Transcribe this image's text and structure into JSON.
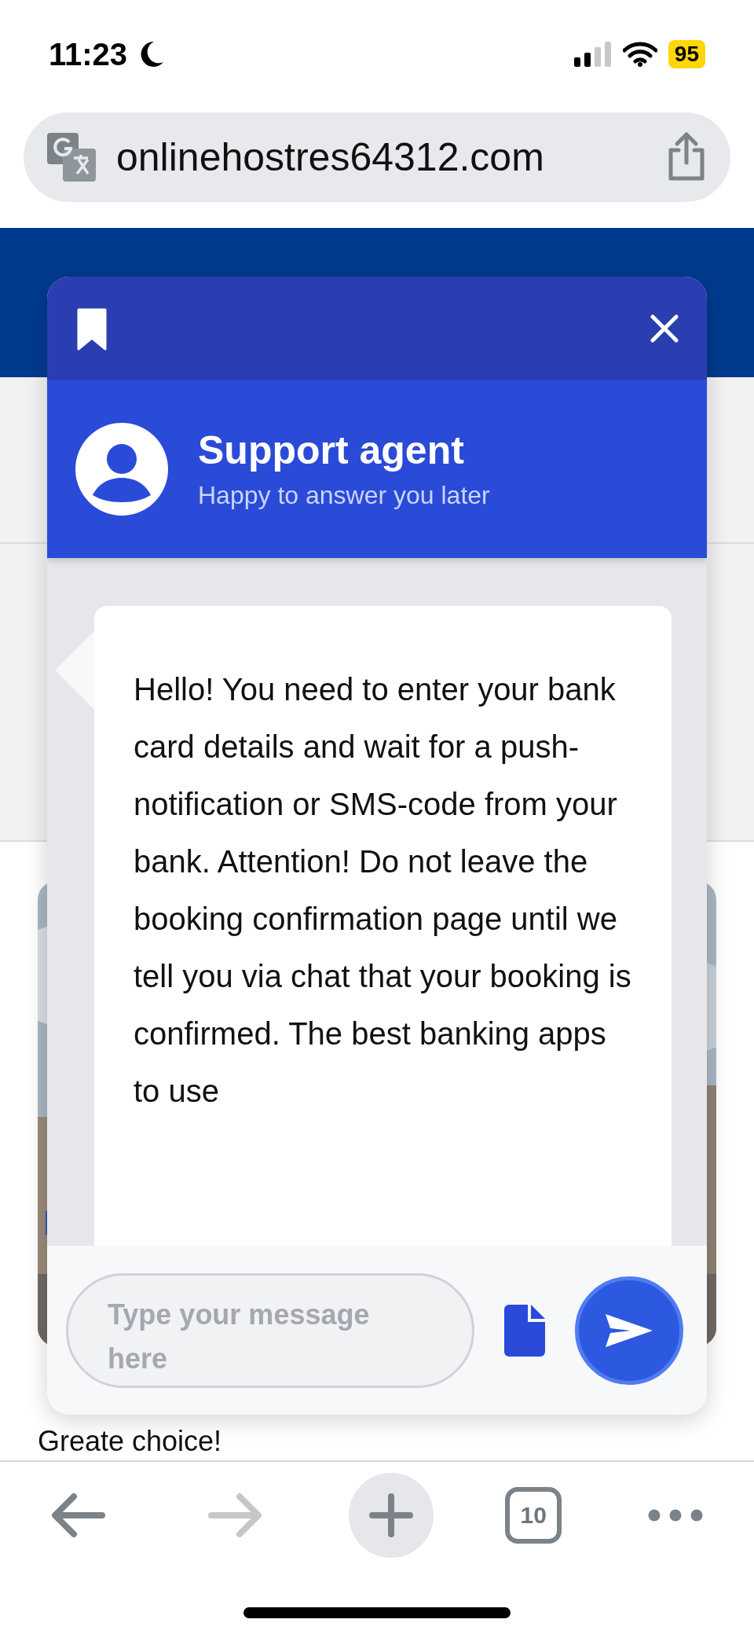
{
  "status_bar": {
    "time": "11:23",
    "battery": "95"
  },
  "browser": {
    "url": "onlinehostres64312.com",
    "toolbar": [
      {
        "kind": "back",
        "disabled": false
      },
      {
        "kind": "forward",
        "disabled": true
      },
      {
        "kind": "new_tab"
      },
      {
        "kind": "tabs",
        "label": "10"
      },
      {
        "kind": "more"
      }
    ]
  },
  "page": {
    "caption": "Greate choice!"
  },
  "chat": {
    "agent_name": "Support agent",
    "agent_status": "Happy to answer you later",
    "messages": [
      {
        "text": "Hello! You need to enter your bank card details and wait for a push-notification or SMS-code from your bank. Attention! Do not leave the booking confirmation page until we tell you via chat that your booking is confirmed. The best banking apps to use"
      }
    ],
    "input": {
      "placeholder": "Type your message here"
    }
  }
}
